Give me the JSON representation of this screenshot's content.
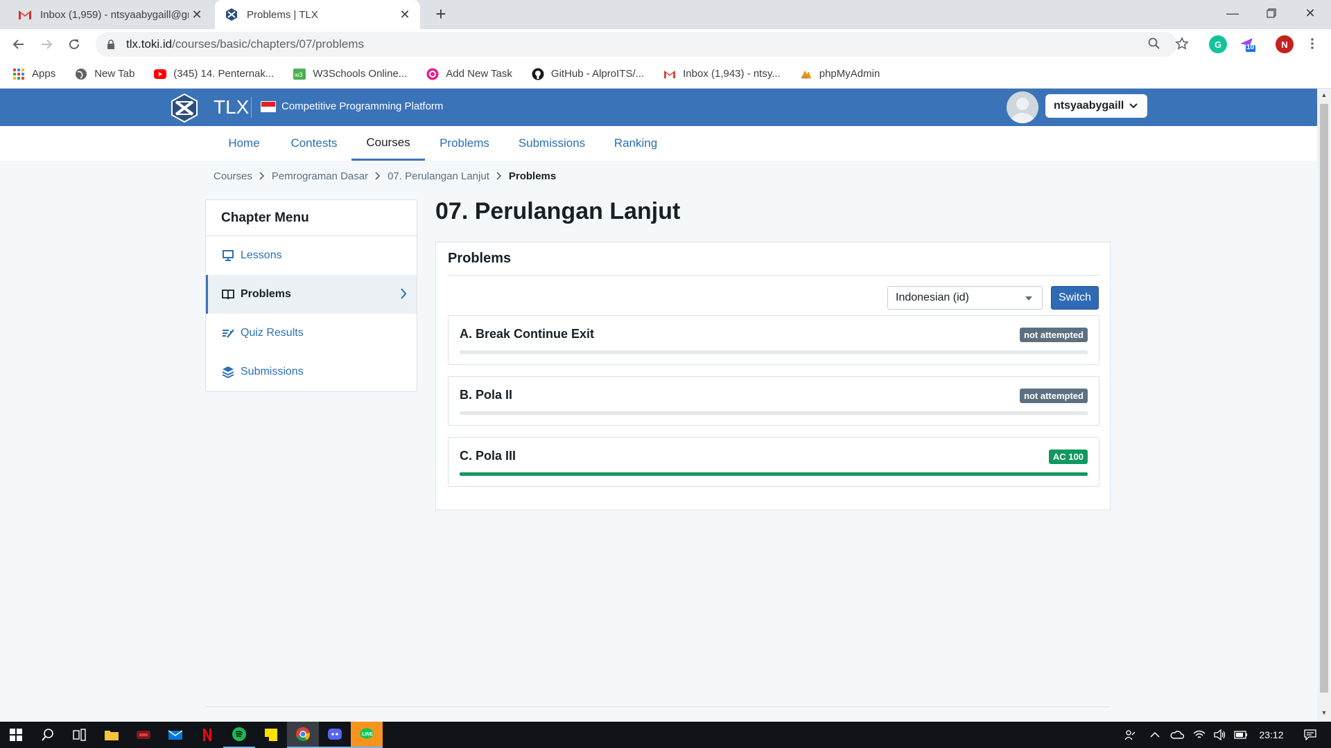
{
  "browser": {
    "tabs": [
      {
        "title": "Inbox (1,959) - ntsyaabygaill@gm",
        "icon": "gmail-icon"
      },
      {
        "title": "Problems | TLX",
        "icon": "tlx-icon"
      }
    ],
    "url_host": "tlx.toki.id",
    "url_path": "/courses/basic/chapters/07/problems",
    "extension_badge": "10",
    "profile_initial": "N",
    "bookmarks": [
      {
        "label": "Apps",
        "icon": "apps-grid-icon"
      },
      {
        "label": "New Tab",
        "icon": "globe-icon"
      },
      {
        "label": "(345) 14. Penternak...",
        "icon": "youtube-icon"
      },
      {
        "label": "W3Schools Online...",
        "icon": "w3schools-icon"
      },
      {
        "label": "Add New Task",
        "icon": "task-icon"
      },
      {
        "label": "GitHub - AlproITS/...",
        "icon": "github-icon"
      },
      {
        "label": "Inbox (1,943) - ntsy...",
        "icon": "gmail-icon"
      },
      {
        "label": "phpMyAdmin",
        "icon": "phpmyadmin-icon"
      }
    ]
  },
  "site": {
    "brand": "TLX",
    "tagline": "Competitive Programming Platform",
    "username": "ntsyaabygaill",
    "nav": [
      "Home",
      "Contests",
      "Courses",
      "Problems",
      "Submissions",
      "Ranking"
    ],
    "active_nav": "Courses",
    "breadcrumb": [
      "Courses",
      "Pemrograman Dasar",
      "07. Perulangan Lanjut",
      "Problems"
    ],
    "chapter_menu": {
      "title": "Chapter Menu",
      "items": [
        {
          "label": "Lessons",
          "icon": "presentation-icon"
        },
        {
          "label": "Problems",
          "icon": "book-icon"
        },
        {
          "label": "Quiz Results",
          "icon": "quiz-icon"
        },
        {
          "label": "Submissions",
          "icon": "layers-icon"
        }
      ],
      "active": "Problems"
    },
    "page_title": "07. Perulangan Lanjut",
    "problems_card": {
      "title": "Problems",
      "language": "Indonesian (id)",
      "switch_label": "Switch",
      "problems": [
        {
          "name": "A. Break Continue Exit",
          "status": "not attempted",
          "badge_color": "#5c7080",
          "progress": 0
        },
        {
          "name": "B. Pola II",
          "status": "not attempted",
          "badge_color": "#5c7080",
          "progress": 0
        },
        {
          "name": "C. Pola III",
          "status": "AC 100",
          "badge_color": "#0f9960",
          "progress": 1
        }
      ]
    }
  },
  "taskbar": {
    "clock": "23:12"
  },
  "colors": {
    "header_blue": "#3b73b9",
    "link_blue": "#2a6fb5",
    "success_green": "#0f9960"
  }
}
